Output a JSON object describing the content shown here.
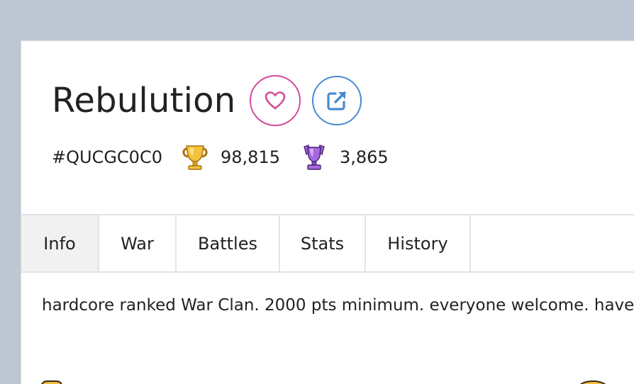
{
  "clan": {
    "name": "Rebulution",
    "tag": "#QUCGC0C0",
    "trophies": "98,815",
    "war_trophies": "3,865",
    "description": "hardcore ranked War Clan. 2000 pts minimum. everyone welcome. have"
  },
  "icons": {
    "favorite": "heart-icon",
    "external": "external-link-icon",
    "trophy": "gold-trophy-icon",
    "war_trophy": "purple-war-trophy-icon"
  },
  "tabs": [
    {
      "label": "Info",
      "active": true
    },
    {
      "label": "War"
    },
    {
      "label": "Battles"
    },
    {
      "label": "Stats"
    },
    {
      "label": "History"
    }
  ],
  "colors": {
    "page_bg": "#bec6d4",
    "favorite_accent": "#d14e9c",
    "link_accent": "#4a8ad0",
    "active_tab_bg": "#f1f1f1"
  }
}
